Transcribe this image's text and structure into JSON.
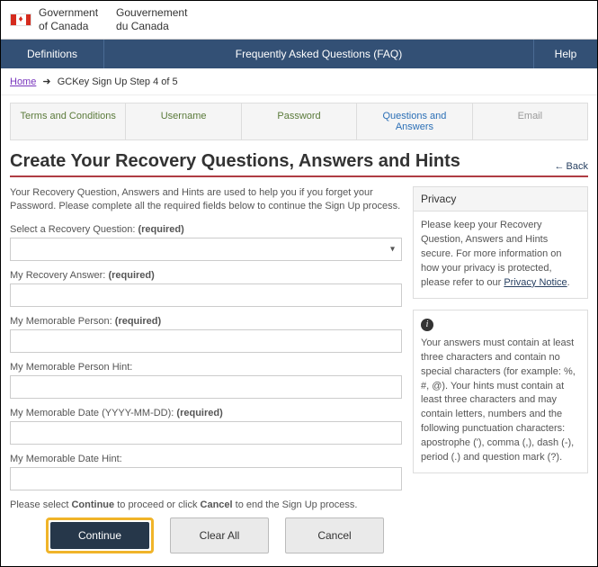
{
  "gov": {
    "en1": "Government",
    "en2": "of Canada",
    "fr1": "Gouvernement",
    "fr2": "du Canada"
  },
  "nav": {
    "definitions": "Definitions",
    "faq": "Frequently Asked Questions (FAQ)",
    "help": "Help"
  },
  "crumbs": {
    "home": "Home",
    "arrow": "➜",
    "current": "GCKey Sign Up Step 4 of 5"
  },
  "steps": {
    "s1": "Terms and Conditions",
    "s2": "Username",
    "s3": "Password",
    "s4": "Questions and Answers",
    "s5": "Email"
  },
  "title": "Create Your Recovery Questions, Answers and Hints",
  "back": {
    "arrow": "←",
    "label": "Back"
  },
  "intro": "Your Recovery Question, Answers and Hints are used to help you if you forget your Password. Please complete all the required fields below to continue the Sign Up process.",
  "labels": {
    "select_q": "Select a Recovery Question:",
    "answer": "My Recovery Answer:",
    "person": "My Memorable Person:",
    "person_hint": "My Memorable Person Hint:",
    "date": "My Memorable Date (YYYY-MM-DD):",
    "date_hint": "My Memorable Date Hint:",
    "required": "(required)"
  },
  "instr": {
    "p1": "Please select ",
    "b1": "Continue",
    "p2": " to proceed or click ",
    "b2": "Cancel",
    "p3": " to end the Sign Up process."
  },
  "buttons": {
    "continue": "Continue",
    "clear": "Clear All",
    "cancel": "Cancel"
  },
  "privacy": {
    "head": "Privacy",
    "body1": "Please keep your Recovery Question, Answers and Hints secure. For more information on how your privacy is protected, please refer to our ",
    "link": "Privacy Notice",
    "body2": "."
  },
  "info": {
    "icon": "i",
    "body": "Your answers must contain at least three characters and contain no special characters (for example: %, #, @). Your hints must contain at least three characters and may contain letters, numbers and the following punctuation characters: apostrophe ('), comma (,), dash (-), period (.) and question mark (?)."
  }
}
